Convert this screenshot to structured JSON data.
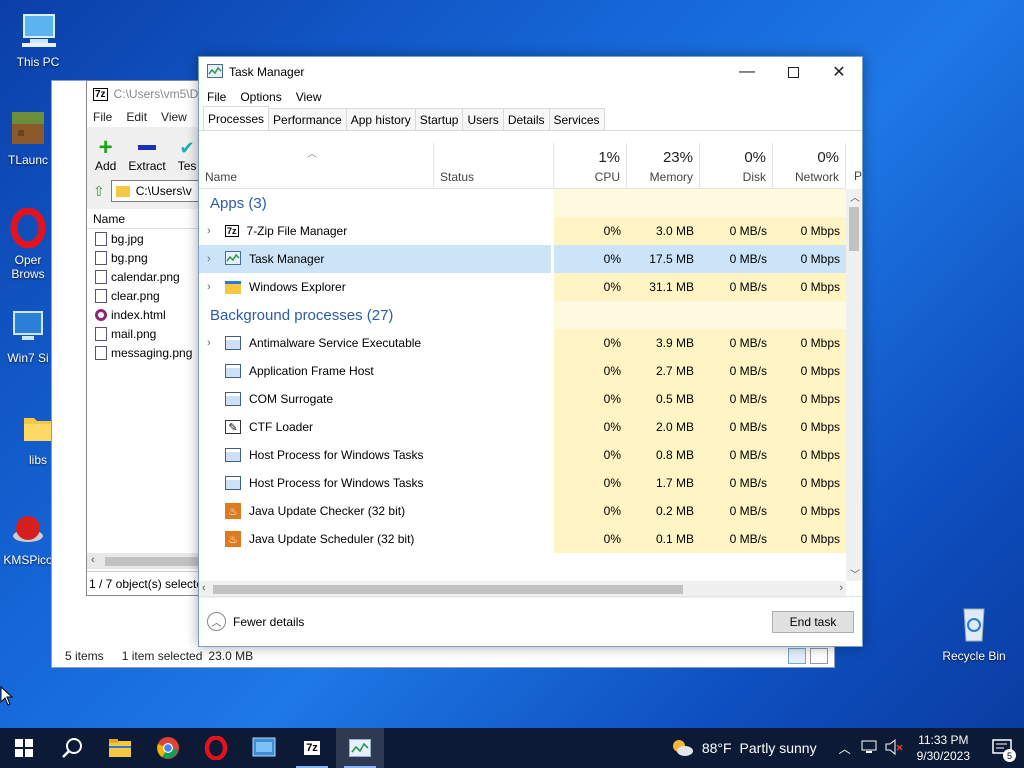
{
  "desktop": {
    "icons": [
      {
        "label": "This PC"
      },
      {
        "label": "TLaunc"
      },
      {
        "label": "Oper Brows"
      },
      {
        "label": "Win7 Si"
      },
      {
        "label": "libs"
      },
      {
        "label": "KMSPico"
      },
      {
        "label": "Recycle Bin"
      }
    ]
  },
  "explorer": {
    "status_items": "5 items",
    "status_selected": "1 item selected",
    "status_size": "23.0 MB"
  },
  "sevenzip": {
    "title": "C:\\Users\\vm5\\D",
    "menu": [
      "File",
      "Edit",
      "View"
    ],
    "toolbar": {
      "add": "Add",
      "extract": "Extract",
      "test": "Tes"
    },
    "address": "C:\\Users\\v",
    "files_header": "Name",
    "files": [
      "bg.jpg",
      "bg.png",
      "calendar.png",
      "clear.png",
      "index.html",
      "mail.png",
      "messaging.png"
    ],
    "status": "1 / 7 object(s) selecte"
  },
  "taskmanager": {
    "title": "Task Manager",
    "menu": [
      "File",
      "Options",
      "View"
    ],
    "tabs": [
      "Processes",
      "Performance",
      "App history",
      "Startup",
      "Users",
      "Details",
      "Services"
    ],
    "header": {
      "name": "Name",
      "status": "Status",
      "cpu_pct": "1%",
      "cpu": "CPU",
      "mem_pct": "23%",
      "mem": "Memory",
      "disk_pct": "0%",
      "disk": "Disk",
      "net_pct": "0%",
      "net": "Network",
      "power": "P"
    },
    "groups": {
      "apps": "Apps (3)",
      "background": "Background processes (27)"
    },
    "apps": [
      {
        "name": "7-Zip File Manager",
        "cpu": "0%",
        "mem": "3.0 MB",
        "disk": "0 MB/s",
        "net": "0 Mbps"
      },
      {
        "name": "Task Manager",
        "cpu": "0%",
        "mem": "17.5 MB",
        "disk": "0 MB/s",
        "net": "0 Mbps"
      },
      {
        "name": "Windows Explorer",
        "cpu": "0%",
        "mem": "31.1 MB",
        "disk": "0 MB/s",
        "net": "0 Mbps"
      }
    ],
    "background": [
      {
        "name": "Antimalware Service Executable",
        "cpu": "0%",
        "mem": "3.9 MB",
        "disk": "0 MB/s",
        "net": "0 Mbps"
      },
      {
        "name": "Application Frame Host",
        "cpu": "0%",
        "mem": "2.7 MB",
        "disk": "0 MB/s",
        "net": "0 Mbps"
      },
      {
        "name": "COM Surrogate",
        "cpu": "0%",
        "mem": "0.5 MB",
        "disk": "0 MB/s",
        "net": "0 Mbps"
      },
      {
        "name": "CTF Loader",
        "cpu": "0%",
        "mem": "2.0 MB",
        "disk": "0 MB/s",
        "net": "0 Mbps"
      },
      {
        "name": "Host Process for Windows Tasks",
        "cpu": "0%",
        "mem": "0.8 MB",
        "disk": "0 MB/s",
        "net": "0 Mbps"
      },
      {
        "name": "Host Process for Windows Tasks",
        "cpu": "0%",
        "mem": "1.7 MB",
        "disk": "0 MB/s",
        "net": "0 Mbps"
      },
      {
        "name": "Java Update Checker (32 bit)",
        "cpu": "0%",
        "mem": "0.2 MB",
        "disk": "0 MB/s",
        "net": "0 Mbps"
      },
      {
        "name": "Java Update Scheduler (32 bit)",
        "cpu": "0%",
        "mem": "0.1 MB",
        "disk": "0 MB/s",
        "net": "0 Mbps"
      }
    ],
    "fewer_details": "Fewer details",
    "end_task": "End task"
  },
  "taskbar": {
    "weather_temp": "88°F",
    "weather_text": "Partly sunny",
    "time": "11:33 PM",
    "date": "9/30/2023",
    "notification_count": "5"
  }
}
